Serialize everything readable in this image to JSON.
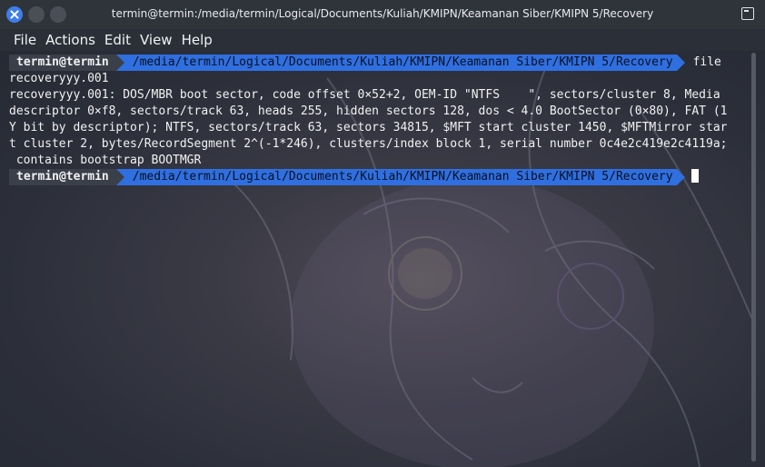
{
  "window": {
    "title": "termin@termin:/media/termin/Logical/Documents/Kuliah/KMIPN/Keamanan Siber/KMIPN 5/Recovery",
    "buttons": [
      "close-icon",
      "minimize-icon",
      "maximize-icon"
    ],
    "accent": "#3d7ee8"
  },
  "menubar": {
    "items": [
      "File",
      "Actions",
      "Edit",
      "View",
      "Help"
    ]
  },
  "terminal": {
    "prompt_user": "termin@termin",
    "prompt_path": "/media/termin/Logical/Documents/Kuliah/KMIPN/Keamanan Siber/KMIPN 5/Recovery",
    "command_part1": "file",
    "command_part2": "recoveryyy.001",
    "output": [
      "recoveryyy.001: DOS/MBR boot sector, code offset 0×52+2, OEM-ID \"NTFS    \", sectors/cluster 8, Media",
      "descriptor 0×f8, sectors/track 63, heads 255, hidden sectors 128, dos < 4.0 BootSector (0×80), FAT (1",
      "Y bit by descriptor); NTFS, sectors/track 63, sectors 34815, $MFT start cluster 1450, $MFTMirror star",
      "t cluster 2, bytes/RecordSegment 2^(-1*246), clusters/index block 1, serial number 0c4e2c419e2c4119a;",
      " contains bootstrap BOOTMGR"
    ],
    "prompt_color": "#2f6fe0"
  }
}
